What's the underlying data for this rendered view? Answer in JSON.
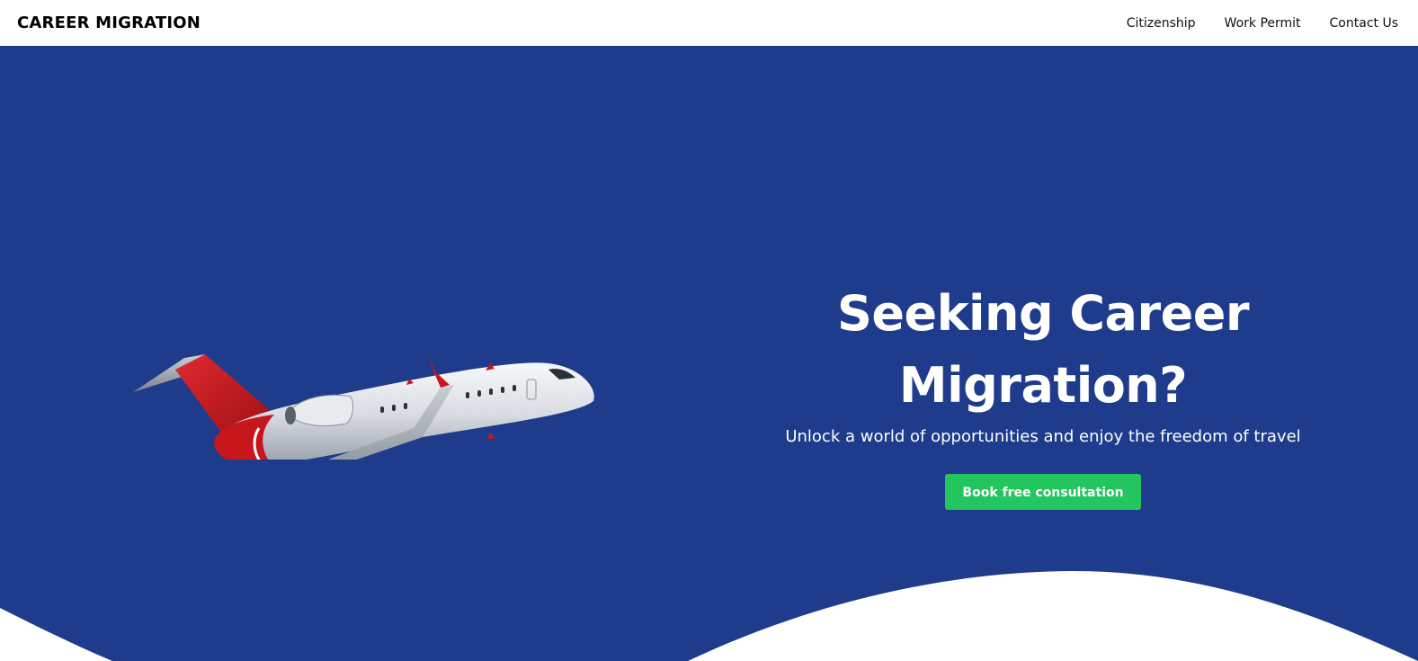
{
  "navbar": {
    "brand": "CAREER MIGRATION",
    "links": [
      {
        "label": "Citizenship"
      },
      {
        "label": "Work Permit"
      },
      {
        "label": "Contact Us"
      }
    ]
  },
  "hero": {
    "title": "Seeking Career Migration?",
    "subtitle": "Unlock a world of opportunities and enjoy the freedom of travel",
    "cta_label": "Book free consultation",
    "illustration": "airplane-illustration"
  },
  "colors": {
    "hero_background": "#1f3b8b",
    "cta_background": "#22c55e",
    "plane_tail": "#c8161d",
    "plane_body": "#e6e9ee"
  }
}
